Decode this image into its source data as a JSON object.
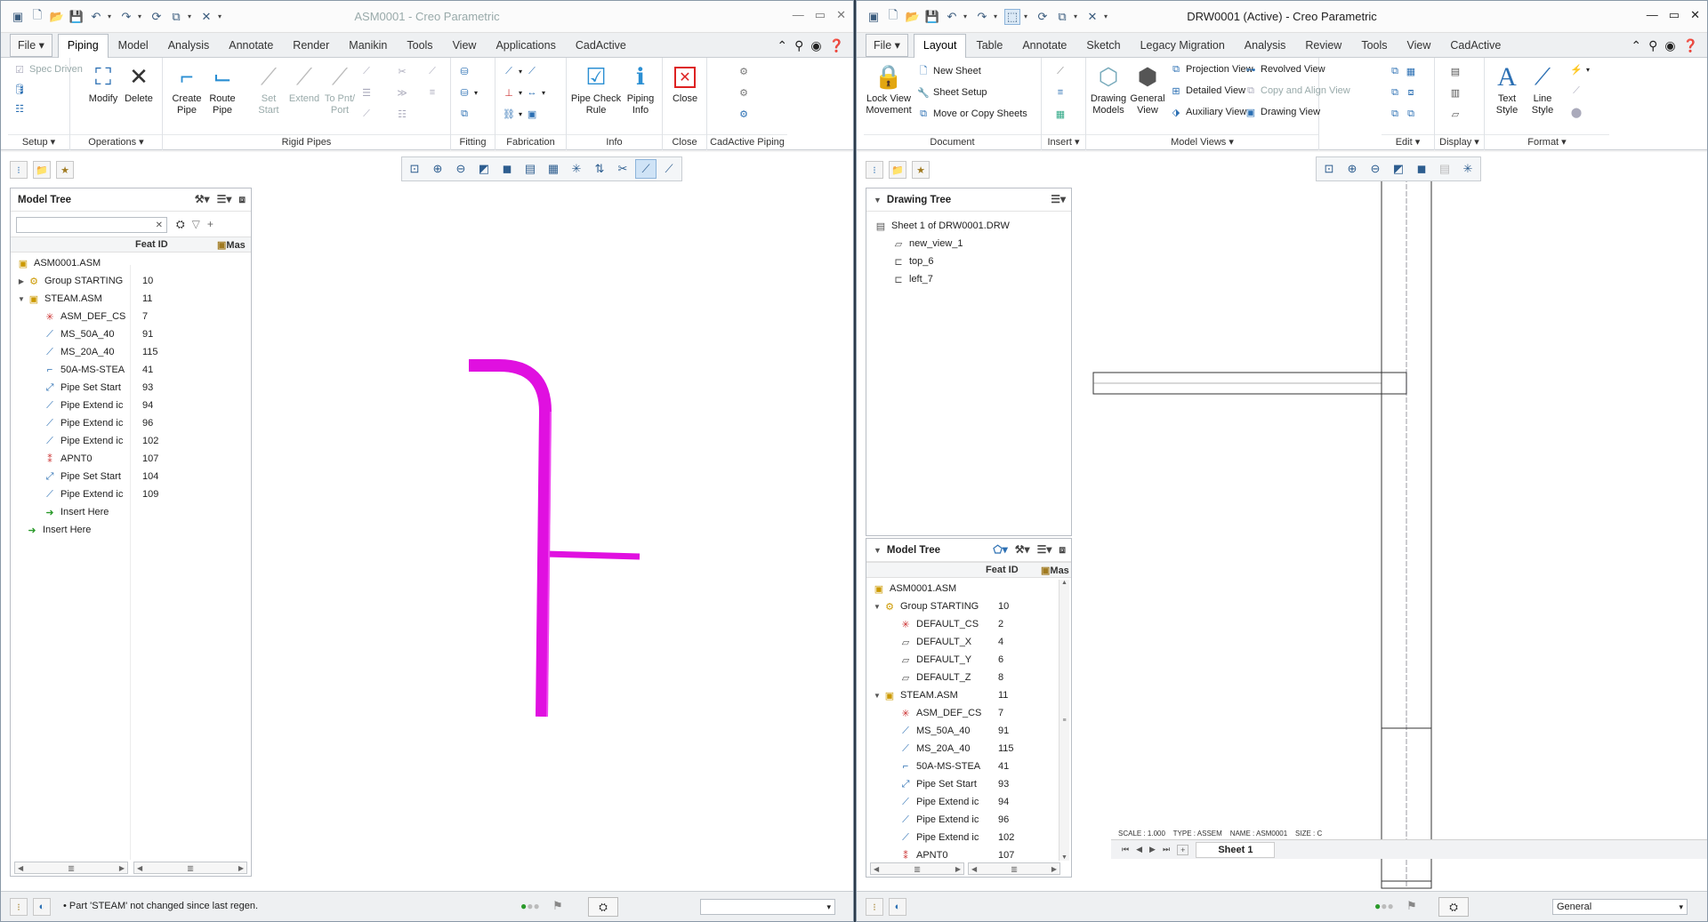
{
  "left": {
    "title": "ASM0001 - Creo Parametric",
    "tabs": [
      "File",
      "Piping",
      "Model",
      "Analysis",
      "Annotate",
      "Render",
      "Manikin",
      "Tools",
      "View",
      "Applications",
      "CadActive"
    ],
    "ribbon": {
      "spec_driven": "Spec Driven",
      "modify": "Modify",
      "delete": "Delete",
      "create_pipe": "Create Pipe",
      "route_pipe": "Route Pipe",
      "set_start": "Set Start",
      "extend": "Extend",
      "to_pnt_port": "To Pnt/ Port",
      "pipe_check_rule": "Pipe Check Rule",
      "piping_info": "Piping Info",
      "close": "Close",
      "groups": [
        "Setup",
        "Operations",
        "Rigid Pipes",
        "Fitting",
        "Fabrication",
        "Info",
        "Close",
        "CadActive Piping"
      ]
    },
    "tree": {
      "header": "Model Tree",
      "col_feat": "Feat ID",
      "col_mas": "Mas",
      "rows": [
        {
          "name": "ASM0001.ASM",
          "id": ""
        },
        {
          "name": "Group STARTING_",
          "id": "10"
        },
        {
          "name": "STEAM.ASM",
          "id": "11"
        },
        {
          "name": "ASM_DEF_CS",
          "id": "7"
        },
        {
          "name": "MS_50A_40",
          "id": "91"
        },
        {
          "name": "MS_20A_40",
          "id": "115"
        },
        {
          "name": "50A-MS-STEA",
          "id": "41"
        },
        {
          "name": "Pipe Set Start",
          "id": "93"
        },
        {
          "name": "Pipe Extend ic",
          "id": "94"
        },
        {
          "name": "Pipe Extend ic",
          "id": "96"
        },
        {
          "name": "Pipe Extend ic",
          "id": "102"
        },
        {
          "name": "APNT0",
          "id": "107"
        },
        {
          "name": "Pipe Set Start",
          "id": "104"
        },
        {
          "name": "Pipe Extend ic",
          "id": "109"
        },
        {
          "name": "Insert Here",
          "id": ""
        },
        {
          "name": "Insert Here",
          "id": ""
        }
      ]
    },
    "status": "Part 'STEAM' not changed since last regen.",
    "pipe_color": "#e010e0"
  },
  "right": {
    "title": "DRW0001 (Active) - Creo Parametric",
    "tabs": [
      "File",
      "Layout",
      "Table",
      "Annotate",
      "Sketch",
      "Legacy Migration",
      "Analysis",
      "Review",
      "Tools",
      "View",
      "CadActive"
    ],
    "ribbon": {
      "lock_view": "Lock View Movement",
      "new_sheet": "New Sheet",
      "sheet_setup": "Sheet Setup",
      "move_copy": "Move or Copy Sheets",
      "drawing_models": "Drawing Models",
      "general_view": "General View",
      "projection_view": "Projection View",
      "detailed_view": "Detailed View",
      "auxiliary_view": "Auxiliary View",
      "revolved_view": "Revolved View",
      "copy_align_view": "Copy and Align View",
      "drawing_view": "Drawing View",
      "text_style": "Text Style",
      "line_style": "Line Style",
      "groups": [
        "Document",
        "Insert",
        "Model Views",
        "Edit",
        "Display",
        "Format"
      ]
    },
    "drawing_tree": {
      "header": "Drawing Tree",
      "rows": [
        "Sheet 1 of DRW0001.DRW",
        "new_view_1",
        "top_6",
        "left_7"
      ]
    },
    "tree": {
      "header": "Model Tree",
      "col_feat": "Feat ID",
      "col_mas": "Mas",
      "rows": [
        {
          "name": "ASM0001.ASM",
          "id": ""
        },
        {
          "name": "Group STARTING_",
          "id": "10"
        },
        {
          "name": "DEFAULT_CS",
          "id": "2"
        },
        {
          "name": "DEFAULT_X",
          "id": "4"
        },
        {
          "name": "DEFAULT_Y",
          "id": "6"
        },
        {
          "name": "DEFAULT_Z",
          "id": "8"
        },
        {
          "name": "STEAM.ASM",
          "id": "11"
        },
        {
          "name": "ASM_DEF_CS",
          "id": "7"
        },
        {
          "name": "MS_50A_40",
          "id": "91"
        },
        {
          "name": "MS_20A_40",
          "id": "115"
        },
        {
          "name": "50A-MS-STEA",
          "id": "41"
        },
        {
          "name": "Pipe Set Start",
          "id": "93"
        },
        {
          "name": "Pipe Extend ic",
          "id": "94"
        },
        {
          "name": "Pipe Extend ic",
          "id": "96"
        },
        {
          "name": "Pipe Extend ic",
          "id": "102"
        },
        {
          "name": "APNT0",
          "id": "107"
        }
      ]
    },
    "scale_info": "SCALE : 1.000    TYPE : ASSEM    NAME : ASM0001    SIZE : C",
    "sheet_tab": "Sheet 1",
    "filter_value": "General"
  }
}
